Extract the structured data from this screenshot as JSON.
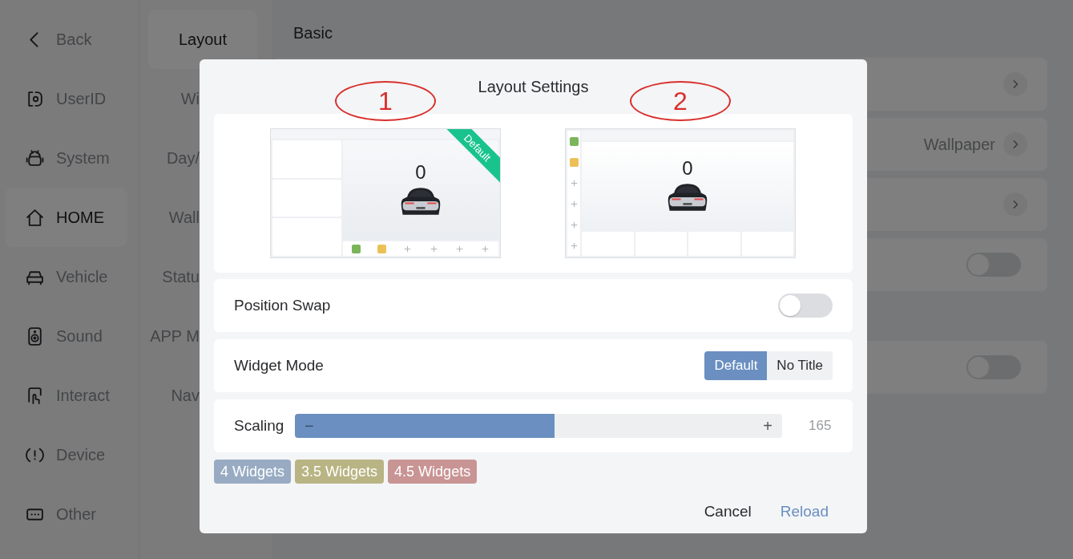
{
  "sidebar": {
    "items": [
      {
        "label": "Back",
        "kind": "back",
        "selected": false
      },
      {
        "label": "UserID",
        "kind": "userid",
        "selected": false
      },
      {
        "label": "System",
        "kind": "system",
        "selected": false
      },
      {
        "label": "HOME",
        "kind": "home",
        "selected": true
      },
      {
        "label": "Vehicle",
        "kind": "vehicle",
        "selected": false
      },
      {
        "label": "Sound",
        "kind": "sound",
        "selected": false
      },
      {
        "label": "Interact",
        "kind": "interact",
        "selected": false
      },
      {
        "label": "Device",
        "kind": "device",
        "selected": false
      },
      {
        "label": "Other",
        "kind": "other",
        "selected": false
      }
    ]
  },
  "subnav": {
    "items": [
      {
        "label": "Layout",
        "selected": true
      },
      {
        "label": "Wi",
        "selected": false
      },
      {
        "label": "Day/",
        "selected": false
      },
      {
        "label": "Wall",
        "selected": false
      },
      {
        "label": "Statu",
        "selected": false
      },
      {
        "label": "APP M",
        "selected": false
      },
      {
        "label": "Nav",
        "selected": false
      }
    ]
  },
  "main": {
    "sections": [
      {
        "title": "Basic",
        "rows": [
          {
            "kind": "link"
          },
          {
            "kind": "link",
            "value": "Wallpaper"
          },
          {
            "kind": "link"
          },
          {
            "kind": "toggle",
            "on": false
          }
        ]
      },
      {
        "rows": [
          {
            "kind": "toggle",
            "on": false
          }
        ]
      }
    ]
  },
  "dialog": {
    "title": "Layout Settings",
    "previews": [
      {
        "kind": "side-widgets",
        "marker": "1",
        "speed": "0",
        "badge": "Default"
      },
      {
        "kind": "bottom-widgets",
        "marker": "2",
        "speed": "0"
      }
    ],
    "rows": [
      {
        "kind": "toggle",
        "label": "Position Swap",
        "on": false
      },
      {
        "kind": "segmented",
        "label": "Widget Mode",
        "options": [
          {
            "label": "Default",
            "selected": true
          },
          {
            "label": "No Title",
            "selected": false
          }
        ]
      },
      {
        "kind": "slider",
        "label": "Scaling",
        "level": 0.533,
        "minus": "−",
        "plus": "+",
        "reading": "165"
      }
    ],
    "presets": [
      {
        "label": "4 Widgets",
        "color": "#98abc3"
      },
      {
        "label": "3.5 Widgets",
        "color": "#b9b483"
      },
      {
        "label": "4.5 Widgets",
        "color": "#c99494"
      }
    ],
    "buttons": [
      {
        "label": "Cancel",
        "kind": "plain"
      },
      {
        "label": "Reload",
        "kind": "primary"
      }
    ]
  }
}
